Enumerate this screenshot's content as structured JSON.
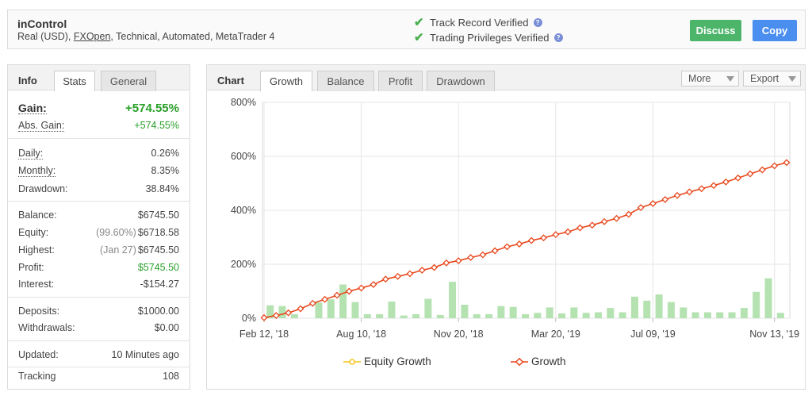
{
  "header": {
    "name": "inControl",
    "details_pre": "Real (USD), ",
    "details_link": "FXOpen",
    "details_post": ", Technical, Automated, MetaTrader 4",
    "verified_track": "Track Record Verified",
    "verified_privileges": "Trading Privileges Verified",
    "discuss_label": "Discuss",
    "copy_label": "Copy"
  },
  "left_panel": {
    "title": "Info",
    "tabs": [
      {
        "label": "Stats",
        "active": true
      },
      {
        "label": "General",
        "active": false
      }
    ],
    "gain": {
      "label": "Gain:",
      "value": "+574.55%"
    },
    "abs_gain": {
      "label": "Abs. Gain:",
      "value": "+574.55%"
    },
    "daily": {
      "label": "Daily:",
      "value": "0.26%"
    },
    "monthly": {
      "label": "Monthly:",
      "value": "8.35%"
    },
    "drawdown": {
      "label": "Drawdown:",
      "value": "38.84%"
    },
    "balance": {
      "label": "Balance:",
      "value": "$6745.50"
    },
    "equity": {
      "label": "Equity:",
      "sub": "(99.60%)",
      "value": "$6718.58"
    },
    "highest": {
      "label": "Highest:",
      "sub": "(Jan 27)",
      "value": "$6745.50"
    },
    "profit": {
      "label": "Profit:",
      "value": "$5745.50"
    },
    "interest": {
      "label": "Interest:",
      "value": "-$154.27"
    },
    "deposits": {
      "label": "Deposits:",
      "value": "$1000.00"
    },
    "withdrawals": {
      "label": "Withdrawals:",
      "value": "$0.00"
    },
    "updated": {
      "label": "Updated:",
      "value": "10 Minutes ago"
    },
    "tracking": {
      "label": "Tracking",
      "value": "108"
    }
  },
  "right_panel": {
    "title": "Chart",
    "tabs": [
      {
        "label": "Growth",
        "active": true
      },
      {
        "label": "Balance",
        "active": false
      },
      {
        "label": "Profit",
        "active": false
      },
      {
        "label": "Drawdown",
        "active": false
      }
    ],
    "more_label": "More",
    "export_label": "Export"
  },
  "colors": {
    "growth": "#e8491f",
    "equity_growth": "#f5c518",
    "bars": "#b5e2b1",
    "green_button": "#4cb56a",
    "blue_button": "#4a8ef0"
  },
  "chart_data": {
    "type": "line",
    "ylim": [
      0,
      800
    ],
    "y_ticks": [
      "0%",
      "200%",
      "400%",
      "600%",
      "800%"
    ],
    "y_tick_values": [
      0,
      200,
      400,
      600,
      800
    ],
    "x_tick_labels": [
      "Feb 12, '18",
      "Aug 10, '18",
      "Nov 20, '18",
      "Mar 20, '19",
      "Jul 09, '19",
      "Nov 13, '19"
    ],
    "x_tick_index": [
      0,
      8,
      16,
      24,
      32,
      42
    ],
    "series": [
      {
        "name": "Growth",
        "values": [
          2,
          10,
          20,
          35,
          55,
          70,
          85,
          100,
          112,
          125,
          145,
          155,
          165,
          178,
          188,
          205,
          213,
          225,
          235,
          250,
          265,
          275,
          288,
          298,
          310,
          320,
          335,
          345,
          358,
          370,
          385,
          410,
          425,
          440,
          455,
          468,
          480,
          492,
          505,
          520,
          535,
          550,
          565,
          577
        ]
      },
      {
        "name": "Equity Growth",
        "values": []
      }
    ],
    "bars": [
      48,
      45,
      15,
      0,
      58,
      70,
      125,
      60,
      15,
      15,
      62,
      10,
      15,
      72,
      12,
      135,
      50,
      15,
      15,
      45,
      42,
      15,
      20,
      40,
      18,
      40,
      20,
      22,
      38,
      22,
      80,
      65,
      88,
      60,
      40,
      22,
      22,
      22,
      22,
      38,
      98,
      148,
      20
    ]
  }
}
